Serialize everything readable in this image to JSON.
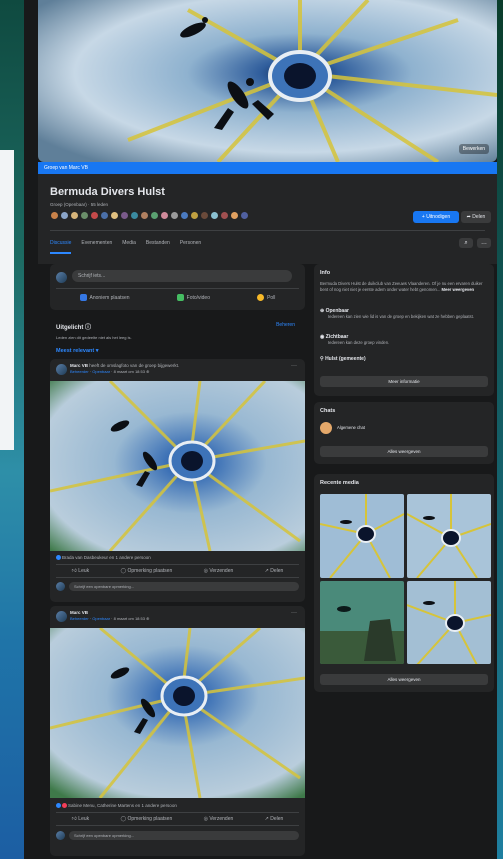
{
  "cover": {
    "banner_text": "Groep van Marc VB",
    "edit_label": "Bewerken"
  },
  "group": {
    "title": "Bermuda Divers Hulst",
    "meta": "Groep (Openbaar) · 55 leden",
    "invite_label": "+ Uitnodigen",
    "share_label": "Delen"
  },
  "tabs": [
    "Discussie",
    "Evenementen",
    "Media",
    "Bestanden",
    "Personen"
  ],
  "composer": {
    "placeholder": "Schrijf iets...",
    "actions": [
      "Anoniem plaatsen",
      "Foto/video",
      "Poll"
    ]
  },
  "featured": {
    "title": "Uitgelicht",
    "subtitle": "Leden zien dit gedeelte niet als het leeg is.",
    "manage_label": "Beheren"
  },
  "sort": {
    "label": "Meest relevant"
  },
  "posts": [
    {
      "author": "Marc VB",
      "author_suffix": "heeft de omslagfoto van de groep bijgewerkt.",
      "role": "Beheerder",
      "badge": "Openbaar",
      "time": "8 maart om 18:53",
      "reactions": "Brada van Dasbeukeur en 1 andere persoon",
      "actions": [
        "Leuk",
        "Opmerking plaatsen",
        "Verzenden",
        "Delen"
      ],
      "comment_placeholder": "Schrijf een openbare opmerking..."
    },
    {
      "author": "Marc VB",
      "author_suffix": "",
      "role": "Beheerder",
      "badge": "Openbaar",
      "time": "8 maart om 18:53",
      "reactions": "Sabine Menu, Catherine Martens en 1 andere persoon",
      "actions": [
        "Leuk",
        "Opmerking plaatsen",
        "Verzenden",
        "Delen"
      ],
      "comment_placeholder": "Schrijf een openbare opmerking..."
    }
  ],
  "info": {
    "title": "Info",
    "description": "Bermuda Divers Hulst de duikclub van Zeeuws Vlaanderen. Of je nu een ervaren duiker bent of nog niet niet je eerste adem onder water hebt genomen...",
    "see_more": "Meer weergeven",
    "public_title": "Openbaar",
    "public_text": "Iedereen kan zien wie lid is van de groep en bekijken wat ze hebben geplaatst.",
    "visible_title": "Zichtbaar",
    "visible_text": "Iedereen kan deze groep vinden.",
    "location": "Hulst (gemeente)",
    "more_info_label": "Meer informatie"
  },
  "chats": {
    "title": "Chats",
    "item": "Algemene chat",
    "show_all": "Alles weergeven"
  },
  "recent_media": {
    "title": "Recente media",
    "show_all": "Alles weergeven"
  },
  "colors": {
    "accent": "#2d88ff",
    "primary_button": "#1877f2",
    "surface": "#242526",
    "background": "#18191a"
  }
}
